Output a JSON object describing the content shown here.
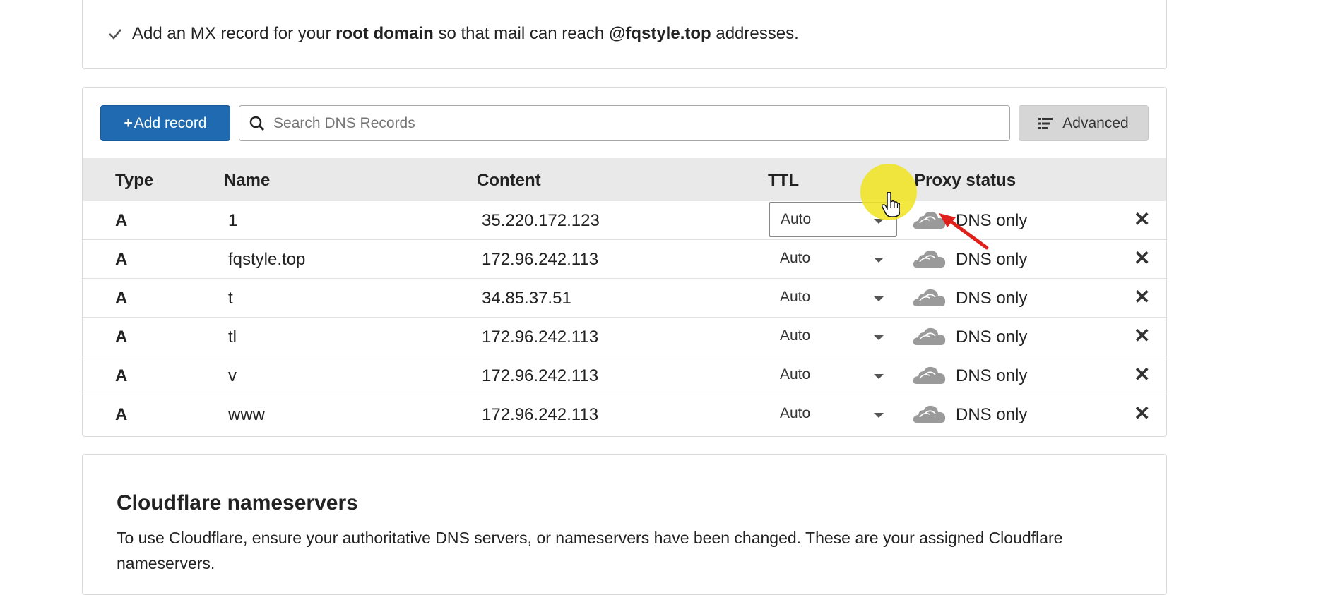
{
  "mx_notice": {
    "prefix": "Add an MX record for your",
    "bold1": "root domain",
    "middle": "so that mail can reach",
    "bold2": "@fqstyle.top",
    "suffix": "addresses."
  },
  "toolbar": {
    "add_label": "Add record",
    "search_placeholder": "Search DNS Records",
    "advanced_label": "Advanced"
  },
  "table": {
    "headers": {
      "type": "Type",
      "name": "Name",
      "content": "Content",
      "ttl": "TTL",
      "proxy": "Proxy status"
    },
    "rows": [
      {
        "type": "A",
        "name": "1",
        "content": "35.220.172.123",
        "ttl": "Auto",
        "proxy": "DNS only"
      },
      {
        "type": "A",
        "name": "fqstyle.top",
        "content": "172.96.242.113",
        "ttl": "Auto",
        "proxy": "DNS only"
      },
      {
        "type": "A",
        "name": "t",
        "content": "34.85.37.51",
        "ttl": "Auto",
        "proxy": "DNS only"
      },
      {
        "type": "A",
        "name": "tl",
        "content": "172.96.242.113",
        "ttl": "Auto",
        "proxy": "DNS only"
      },
      {
        "type": "A",
        "name": "v",
        "content": "172.96.242.113",
        "ttl": "Auto",
        "proxy": "DNS only"
      },
      {
        "type": "A",
        "name": "www",
        "content": "172.96.242.113",
        "ttl": "Auto",
        "proxy": "DNS only"
      }
    ]
  },
  "nameservers": {
    "title": "Cloudflare nameservers",
    "description": "To use Cloudflare, ensure your authoritative DNS servers, or nameservers have been changed. These are your assigned Cloudflare nameservers."
  },
  "colors": {
    "primary_button": "#1f6ab0",
    "highlight": "#f0e41e",
    "arrow": "#e0201a"
  },
  "icons": [
    "check-icon",
    "plus-icon",
    "search-icon",
    "filter-list-icon",
    "caret-down-icon",
    "cloud-icon",
    "close-icon",
    "hand-cursor-icon",
    "red-arrow-icon"
  ]
}
